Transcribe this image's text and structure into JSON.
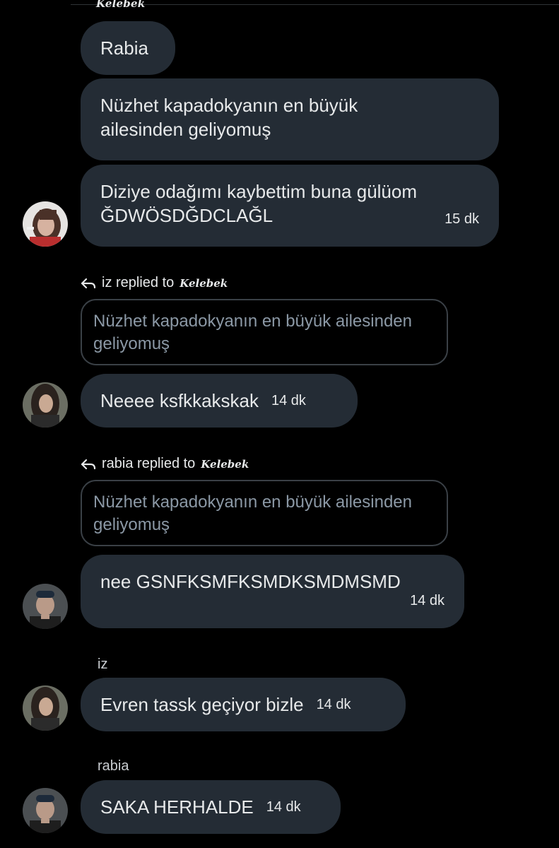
{
  "colors": {
    "background": "#000000",
    "bubble": "#242c35",
    "quote_border": "#3a4046",
    "muted_text": "#8b98a5"
  },
  "thread_top": {
    "sender": "Kelebek"
  },
  "messages_group1": [
    {
      "text": "Rabia"
    },
    {
      "text": "Nüzhet kapadokyanın en büyük ailesinden geliyomuş"
    },
    {
      "text": "Diziye odağımı kaybettim buna gülüom ĞDWÖSDĞDCLAĞL",
      "time": "15 dk"
    }
  ],
  "reply1": {
    "header": "iz replied to",
    "target": "Kelebek",
    "quoted": "Nüzhet kapadokyanın en büyük ailesinden geliyomuş",
    "message": "Neeee ksfkkakskak",
    "time": "14 dk"
  },
  "reply2": {
    "header": "rabia replied to",
    "target": "Kelebek",
    "quoted": "Nüzhet kapadokyanın en büyük ailesinden geliyomuş",
    "message": "nee GSNFKSMFKSMDKSMDMSMD",
    "time": "14 dk"
  },
  "msg_iz": {
    "name": "iz",
    "message": "Evren tassk geçiyor bizle",
    "time": "14 dk"
  },
  "msg_rabia": {
    "name": "rabia",
    "message": "SAKA HERHALDE",
    "time": "14 dk"
  },
  "icons": [
    "reply-arrow-icon"
  ]
}
